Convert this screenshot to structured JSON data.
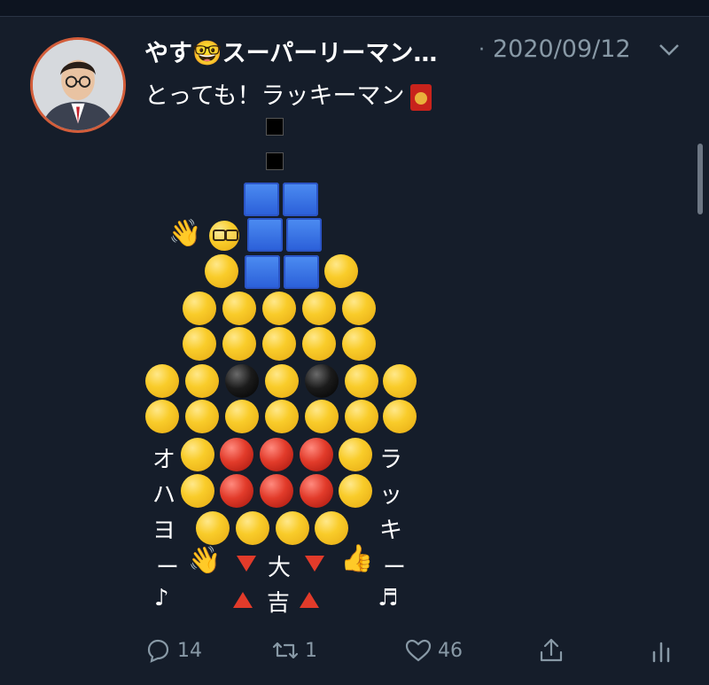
{
  "tweet": {
    "display_name": "やす🤓スーパーリーマン…",
    "separator": "·",
    "date": "2020/09/12",
    "text": "とっても！ラッキーマン",
    "text_emoji": "red-envelope-icon"
  },
  "art": {
    "left_column": [
      "オ",
      "ハ",
      "ヨ",
      "ー",
      "♪"
    ],
    "right_column": [
      "ラ",
      "ッ",
      "キ",
      "ー",
      "♬"
    ],
    "center_top": "大",
    "center_bottom": "吉"
  },
  "actions": {
    "reply_count": "14",
    "retweet_count": "1",
    "like_count": "46"
  },
  "colors": {
    "background": "#151d2a",
    "secondary_text": "#8899a6",
    "avatar_border": "#d35d3a"
  }
}
